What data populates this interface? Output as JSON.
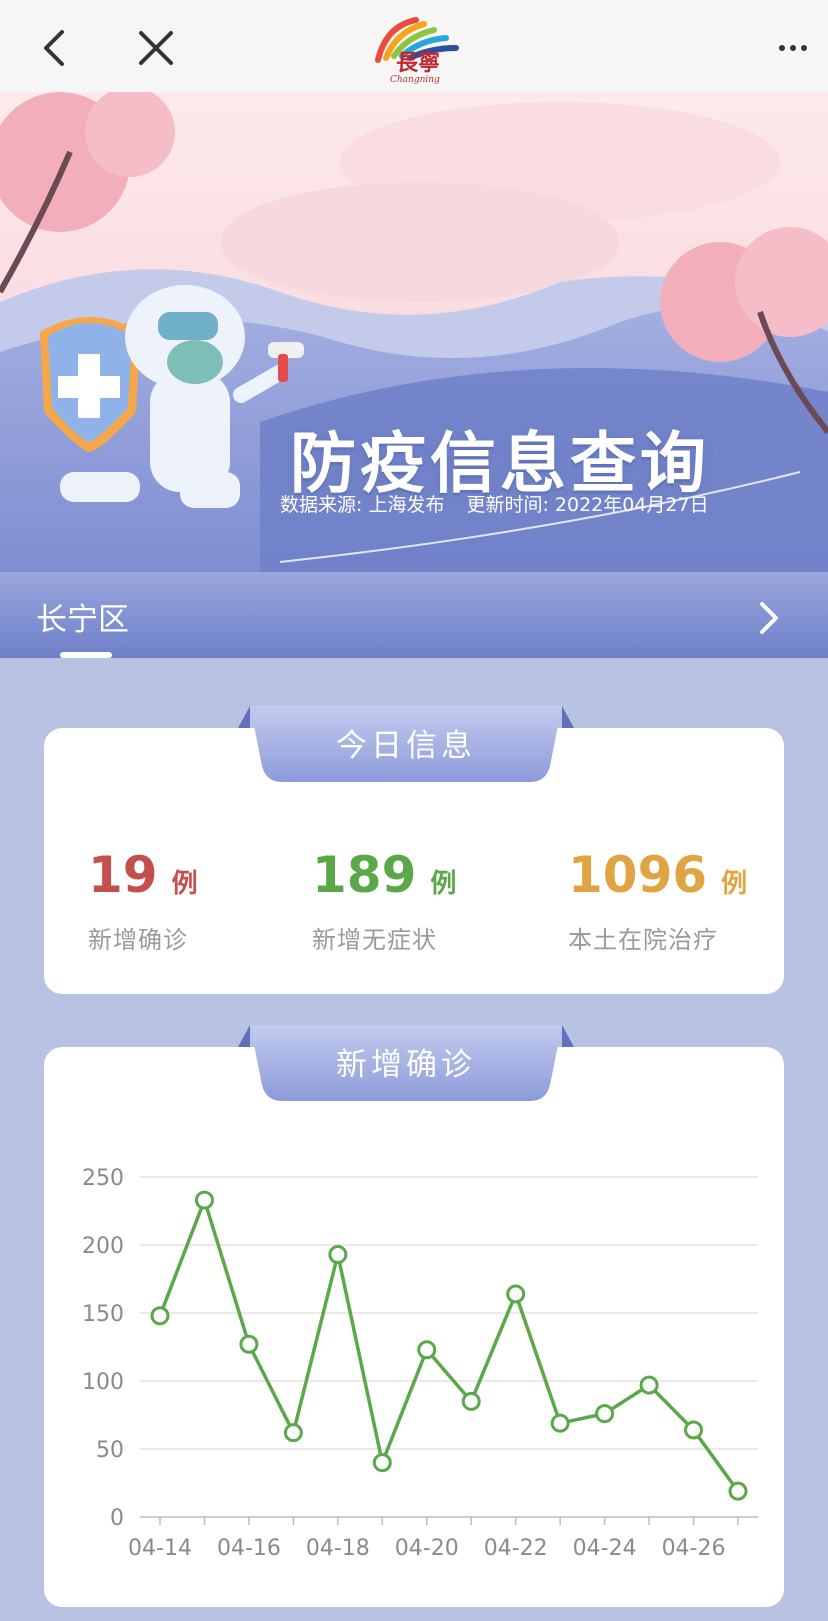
{
  "nav": {
    "back_icon": "chevron-left-icon",
    "close_icon": "close-icon",
    "more_icon": "more-icon",
    "logo_text": "長寧",
    "logo_subtext": "Changning"
  },
  "banner": {
    "title": "防疫信息查询",
    "source": "数据来源: 上海发布",
    "updated": "更新时间: 2022年04月27日"
  },
  "district": {
    "name": "长宁区",
    "arrow_icon": "chevron-right-icon"
  },
  "today": {
    "section_label": "今日信息",
    "stats": [
      {
        "value": "19",
        "unit": "例",
        "label": "新增确诊",
        "color": "#c5504b"
      },
      {
        "value": "189",
        "unit": "例",
        "label": "新增无症状",
        "color": "#5aa84a"
      },
      {
        "value": "1096",
        "unit": "例",
        "label": "本土在院治疗",
        "color": "#e0a442"
      }
    ]
  },
  "trend": {
    "section_label": "新增确诊"
  },
  "chart_data": {
    "type": "line",
    "title": "",
    "xlabel": "",
    "ylabel": "",
    "x": [
      "04-14",
      "04-15",
      "04-16",
      "04-17",
      "04-18",
      "04-19",
      "04-20",
      "04-21",
      "04-22",
      "04-23",
      "04-24",
      "04-25",
      "04-26",
      "04-27"
    ],
    "xtick_labels": [
      "04-14",
      "04-16",
      "04-18",
      "04-20",
      "04-22",
      "04-24",
      "04-26"
    ],
    "values": [
      148,
      233,
      127,
      62,
      193,
      40,
      123,
      85,
      164,
      69,
      76,
      97,
      64,
      19
    ],
    "ylim": [
      0,
      250
    ],
    "yticks": [
      "0",
      "50",
      "100",
      "150",
      "200",
      "250"
    ],
    "grid": true,
    "color": "#5aa84a"
  }
}
